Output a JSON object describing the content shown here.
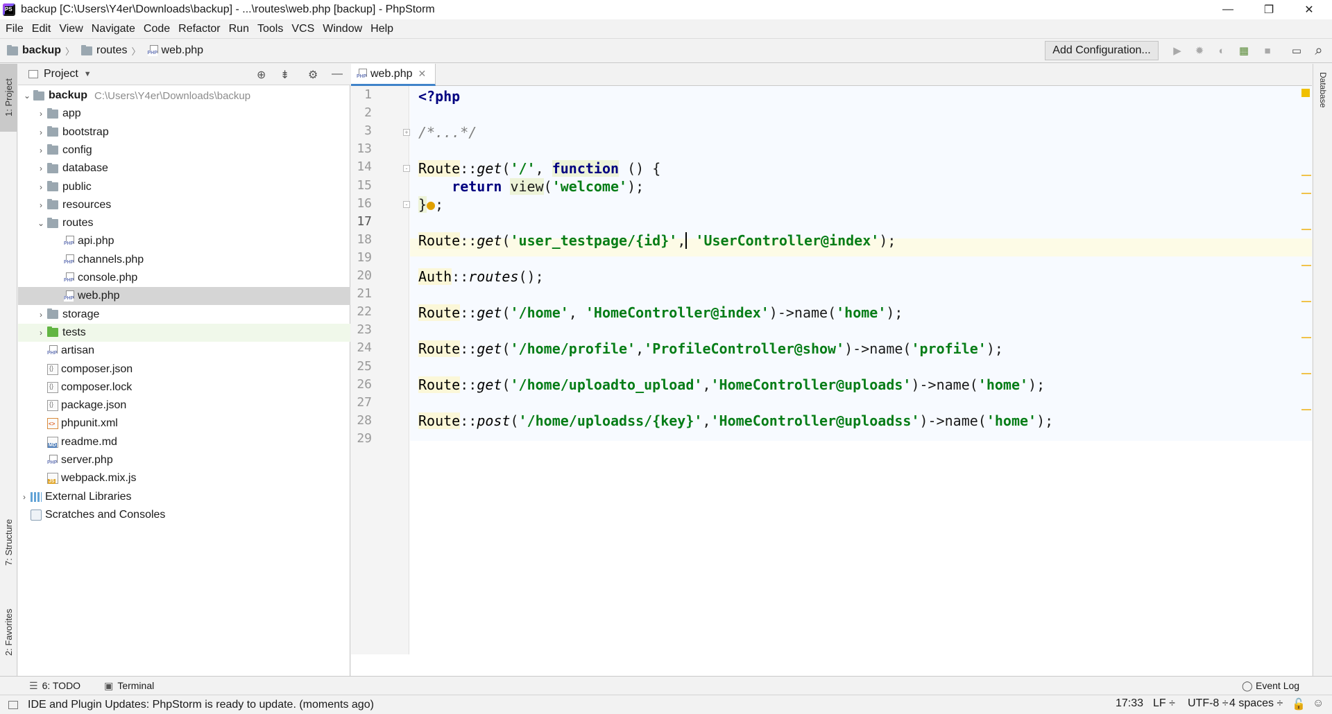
{
  "window": {
    "title": "backup [C:\\Users\\Y4er\\Downloads\\backup] - ...\\routes\\web.php [backup] - PhpStorm",
    "logo_text": "PS",
    "minimize": "—",
    "restore": "❐",
    "close": "✕"
  },
  "menu": [
    "File",
    "Edit",
    "View",
    "Navigate",
    "Code",
    "Refactor",
    "Run",
    "Tools",
    "VCS",
    "Window",
    "Help"
  ],
  "breadcrumb": [
    "backup",
    "routes",
    "web.php"
  ],
  "toolbar": {
    "add_config": "Add Configuration...",
    "run_icon": "▶",
    "debug_icon": "✹",
    "coverage_icon": "◐",
    "profile_icon": "▦",
    "stop_icon": "■",
    "layout_icon": "▭",
    "search_icon": "⌕"
  },
  "sidebar": {
    "project_tab": "1: Project",
    "structure_tab": "7: Structure",
    "favorites_tab": "2: Favorites"
  },
  "project": {
    "title": "Project",
    "root": {
      "name": "backup",
      "path": "C:\\Users\\Y4er\\Downloads\\backup"
    },
    "folders_top": [
      "app",
      "bootstrap",
      "config",
      "database",
      "public",
      "resources"
    ],
    "routes_folder": "routes",
    "routes_files": [
      "api.php",
      "channels.php",
      "console.php",
      "web.php"
    ],
    "selected_file": "web.php",
    "folders_bottom": [
      "storage",
      "tests"
    ],
    "root_files": [
      {
        "name": "artisan",
        "type": "php"
      },
      {
        "name": "composer.json",
        "type": "json"
      },
      {
        "name": "composer.lock",
        "type": "json"
      },
      {
        "name": "package.json",
        "type": "json"
      },
      {
        "name": "phpunit.xml",
        "type": "xml"
      },
      {
        "name": "readme.md",
        "type": "md"
      },
      {
        "name": "server.php",
        "type": "php"
      },
      {
        "name": "webpack.mix.js",
        "type": "js"
      }
    ],
    "external_libraries": "External Libraries",
    "scratches": "Scratches and Consoles"
  },
  "editor": {
    "tab": "web.php",
    "line_numbers": [
      "1",
      "2",
      "3",
      "13",
      "14",
      "15",
      "16",
      "17",
      "18",
      "19",
      "20",
      "21",
      "22",
      "23",
      "24",
      "25",
      "26",
      "27",
      "28",
      "29"
    ],
    "current_line": "17"
  },
  "right_sidebar": {
    "database_tab": "Database"
  },
  "bottom_tabs": {
    "todo": "6: TODO",
    "terminal": "Terminal",
    "event_log": "Event Log"
  },
  "status": {
    "message": "IDE and Plugin Updates: PhpStorm is ready to update. (moments ago)",
    "position": "17:33",
    "line_sep": "LF ÷",
    "encoding": "UTF-8 ÷",
    "indent": "4 spaces ÷"
  }
}
